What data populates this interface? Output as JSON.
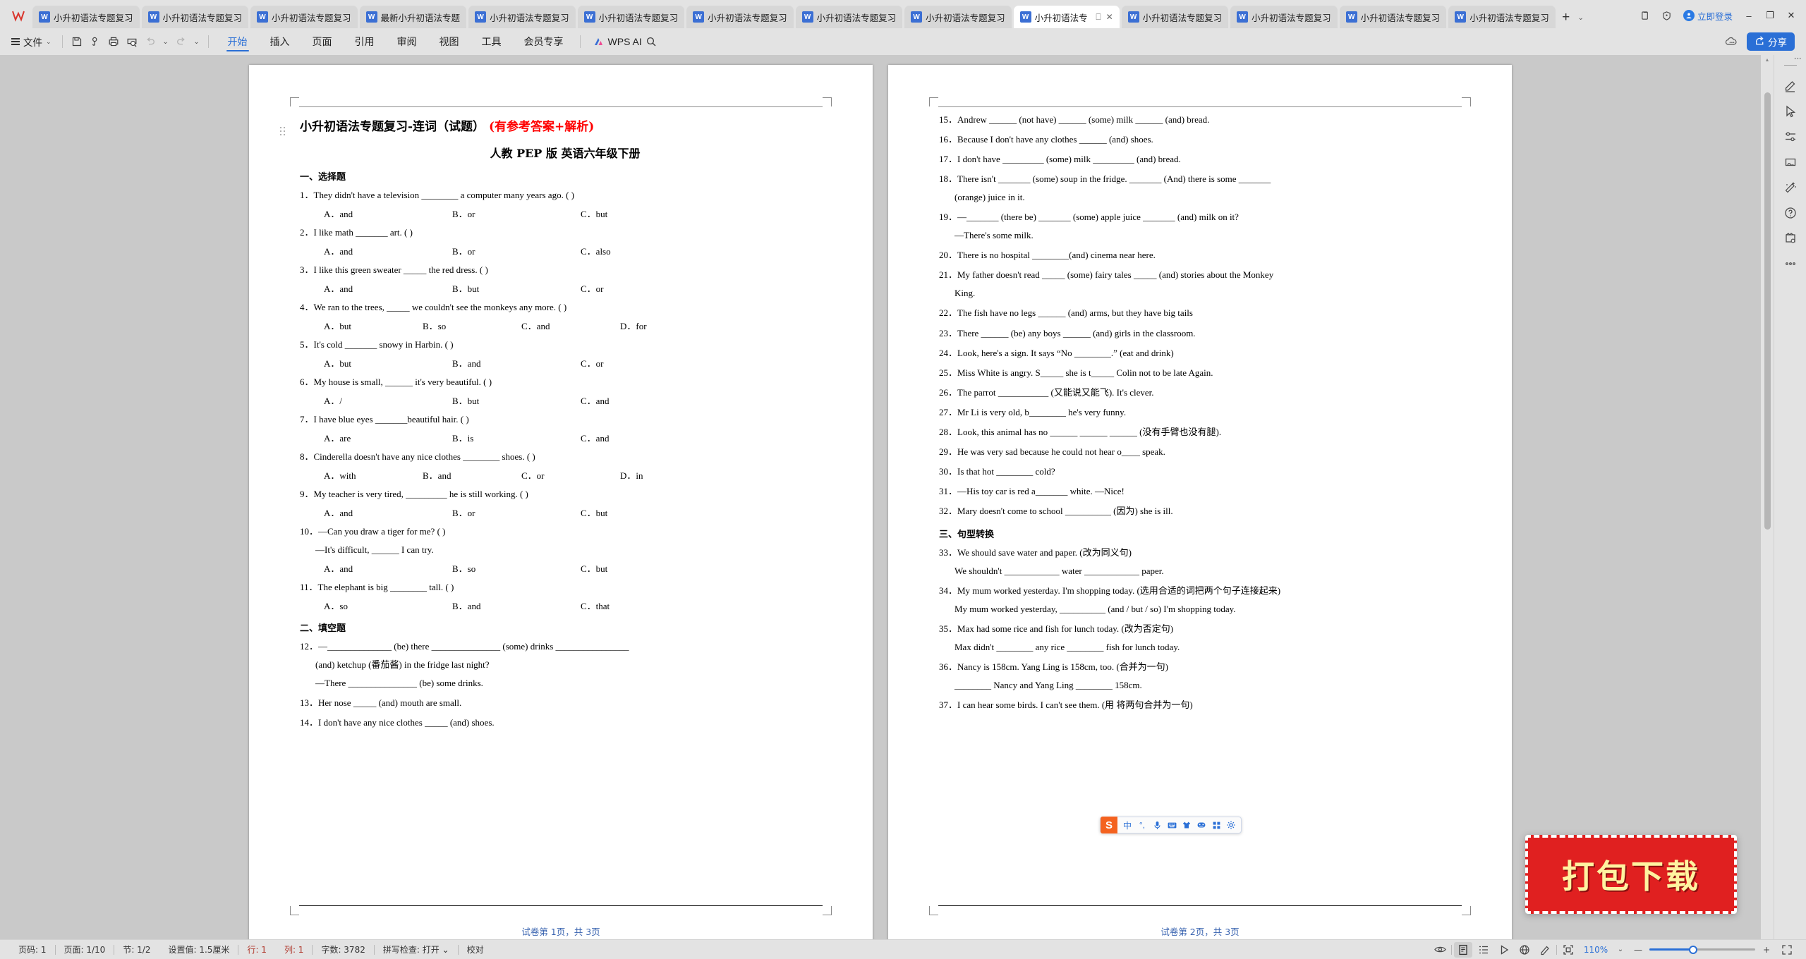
{
  "window": {
    "app_logo": "W",
    "tabs": [
      {
        "label": "小升初语法专题复习",
        "icon": "W",
        "active": false
      },
      {
        "label": "小升初语法专题复习",
        "icon": "W",
        "active": false
      },
      {
        "label": "小升初语法专题复习",
        "icon": "W",
        "active": false
      },
      {
        "label": "最新小升初语法专题",
        "icon": "W",
        "active": false
      },
      {
        "label": "小升初语法专题复习",
        "icon": "W",
        "active": false
      },
      {
        "label": "小升初语法专题复习",
        "icon": "W",
        "active": false
      },
      {
        "label": "小升初语法专题复习",
        "icon": "W",
        "active": false
      },
      {
        "label": "小升初语法专题复习",
        "icon": "W",
        "active": false
      },
      {
        "label": "小升初语法专题复习",
        "icon": "W",
        "active": false
      },
      {
        "label": "小升初语法专",
        "icon": "W",
        "active": true
      },
      {
        "label": "小升初语法专题复习",
        "icon": "W",
        "active": false
      },
      {
        "label": "小升初语法专题复习",
        "icon": "W",
        "active": false
      },
      {
        "label": "小升初语法专题复习",
        "icon": "W",
        "active": false
      },
      {
        "label": "小升初语法专题复习",
        "icon": "W",
        "active": false
      }
    ],
    "new_tab": "+",
    "tab_dropdown": "⌄",
    "login_label": "立即登录",
    "minimize": "–",
    "maximize": "❐",
    "close": "✕"
  },
  "ribbon": {
    "file_label": "文件",
    "tabs": [
      {
        "label": "开始",
        "active": true
      },
      {
        "label": "插入",
        "active": false
      },
      {
        "label": "页面",
        "active": false
      },
      {
        "label": "引用",
        "active": false
      },
      {
        "label": "审阅",
        "active": false
      },
      {
        "label": "视图",
        "active": false
      },
      {
        "label": "工具",
        "active": false
      },
      {
        "label": "会员专享",
        "active": false
      }
    ],
    "ai_label": "WPS AI",
    "share_label": "分享",
    "share_color": "#2a6fd6"
  },
  "document": {
    "title_main": "小升初语法专题复习-连词（试题）",
    "title_red": "(有参考答案+解析)",
    "subtitle": "人教 PEP 版 英语六年级下册",
    "page1_footer": "试卷第 1页，共 3页",
    "page2_footer": "试卷第 2页，共 3页",
    "section1_head": "一、选择题",
    "section2_head": "二、填空题",
    "section3_head": "三、句型转换",
    "page1_items": [
      {
        "kind": "q",
        "text": "1．They didn't have a television ________ a computer many years ago. (        )"
      },
      {
        "kind": "opt3",
        "a": "A．and",
        "b": "B．or",
        "c": "C．but"
      },
      {
        "kind": "q",
        "text": "2．I like math _______ art. (        )"
      },
      {
        "kind": "opt3",
        "a": "A．and",
        "b": "B．or",
        "c": "C．also"
      },
      {
        "kind": "q",
        "text": "3．I like this green sweater _____ the red dress. (  )"
      },
      {
        "kind": "opt3",
        "a": "A．and",
        "b": "B．but",
        "c": "C．or"
      },
      {
        "kind": "q",
        "text": "4．We ran to the trees, _____ we couldn't see the monkeys any more. (  )"
      },
      {
        "kind": "opt4",
        "a": "A．but",
        "b": "B．so",
        "c": "C．and",
        "d": "D．for"
      },
      {
        "kind": "q",
        "text": "5．It's cold _______ snowy in Harbin. (  )"
      },
      {
        "kind": "opt3",
        "a": "A．but",
        "b": "B．and",
        "c": "C．or"
      },
      {
        "kind": "q",
        "text": "6．My house is small, ______ it's very beautiful. (  )"
      },
      {
        "kind": "opt3",
        "a": "A．/",
        "b": "B．but",
        "c": "C．and"
      },
      {
        "kind": "q",
        "text": "7．I have blue eyes _______beautiful hair. (  )"
      },
      {
        "kind": "opt3",
        "a": "A．are",
        "b": "B．is",
        "c": "C．and"
      },
      {
        "kind": "q",
        "text": "8．Cinderella doesn't have any nice clothes ________ shoes. (  )"
      },
      {
        "kind": "opt4",
        "a": "A．with",
        "b": "B．and",
        "c": "C．or",
        "d": "D．in"
      },
      {
        "kind": "q",
        "text": "9．My teacher is very tired, _________ he is still working.   (      )"
      },
      {
        "kind": "opt3",
        "a": "A．and",
        "b": "B．or",
        "c": "C．but"
      },
      {
        "kind": "q",
        "text": "10．—Can you draw a tiger for me? (  )"
      },
      {
        "kind": "plain",
        "text": "—It's difficult, ______ I can try."
      },
      {
        "kind": "opt3",
        "a": "A．and",
        "b": "B．so",
        "c": "C．but"
      },
      {
        "kind": "q",
        "text": "11．The elephant is big ________ tall. (  )"
      },
      {
        "kind": "opt3",
        "a": "A．so",
        "b": "B．and",
        "c": "C．that"
      },
      {
        "kind": "head2",
        "text": "二、填空题"
      },
      {
        "kind": "q",
        "text": "12．—______________ (be) there _______________ (some) drinks ________________"
      },
      {
        "kind": "plain",
        "text": "(and) ketchup (番茄酱) in the fridge last night?"
      },
      {
        "kind": "plain",
        "text": "—There _______________ (be) some drinks."
      },
      {
        "kind": "q",
        "text": "13．Her nose _____ (and) mouth are small."
      },
      {
        "kind": "q",
        "text": "14．I don't have any nice clothes _____ (and) shoes."
      }
    ],
    "page2_items": [
      {
        "kind": "q",
        "text": "15．Andrew ______ (not have) ______ (some) milk ______ (and) bread."
      },
      {
        "kind": "q",
        "text": "16．Because I don't have any clothes ______ (and) shoes."
      },
      {
        "kind": "q",
        "text": "17．I don't have _________ (some) milk _________ (and) bread."
      },
      {
        "kind": "q",
        "text": "18．There isn't _______ (some) soup in the fridge. _______ (And) there is some _______"
      },
      {
        "kind": "plain",
        "text": "(orange) juice in it."
      },
      {
        "kind": "q",
        "text": "19．—_______ (there be) _______ (some) apple juice _______ (and) milk on it?"
      },
      {
        "kind": "plain",
        "text": "—There's some milk."
      },
      {
        "kind": "q",
        "text": "20．There is no hospital ________(and) cinema near here."
      },
      {
        "kind": "q",
        "text": "21．My father doesn't read _____ (some) fairy tales _____ (and) stories about the Monkey"
      },
      {
        "kind": "plain",
        "text": "King."
      },
      {
        "kind": "q",
        "text": "22．The fish have no legs ______ (and) arms, but they have big tails"
      },
      {
        "kind": "q",
        "text": "23．There ______ (be) any boys ______ (and) girls in the classroom."
      },
      {
        "kind": "q",
        "text": "24．Look, here's a sign. It says “No ________.” (eat and drink)"
      },
      {
        "kind": "q",
        "text": "25．Miss White is angry. S_____ she is t_____ Colin not to be late Again."
      },
      {
        "kind": "q",
        "text": "26．The parrot ___________ (又能说又能飞). It's clever."
      },
      {
        "kind": "q",
        "text": "27．Mr Li is very old, b________ he's very funny."
      },
      {
        "kind": "q",
        "text": "28．Look, this animal has no ______ ______ ______ (没有手臂也没有腿)."
      },
      {
        "kind": "q",
        "text": "29．He was very sad because he could not hear o____ speak."
      },
      {
        "kind": "q",
        "text": "30．Is that hot ________ cold?"
      },
      {
        "kind": "q",
        "text": "31．—His toy car is red a_______ white. —Nice!"
      },
      {
        "kind": "q",
        "text": "32．Mary doesn't come to school __________ (因为) she is ill."
      },
      {
        "kind": "head3",
        "text": "三、句型转换"
      },
      {
        "kind": "q",
        "text": "33．We should save water and paper. (改为同义句)"
      },
      {
        "kind": "plain",
        "text": "We shouldn't ____________ water ____________ paper."
      },
      {
        "kind": "q",
        "text": "34．My mum worked yesterday. I'm shopping today. (选用合适的词把两个句子连接起来)"
      },
      {
        "kind": "plain",
        "text": "My mum worked yesterday, __________ (and / but / so) I'm shopping today."
      },
      {
        "kind": "q",
        "text": "35．Max had some rice and fish for lunch today. (改为否定句)"
      },
      {
        "kind": "plain",
        "text": "Max didn't ________ any rice ________ fish for lunch today."
      },
      {
        "kind": "q",
        "text": "36．Nancy is 158cm. Yang Ling is 158cm, too. (合并为一句)"
      },
      {
        "kind": "plain",
        "text": "________ Nancy and Yang Ling ________ 158cm."
      },
      {
        "kind": "q",
        "text": "37．I can hear some birds. I can't see them. (用 将两句合并为一句)"
      }
    ]
  },
  "ime": {
    "logo": "S",
    "buttons": [
      "中",
      "°,",
      "mic-icon",
      "keyboard-icon",
      "skin-icon",
      "emoji-icon",
      "apps-icon",
      "settings-icon"
    ]
  },
  "watermark": {
    "text": "打包下载",
    "bg_color": "#e02020",
    "text_color": "#fff3a0"
  },
  "statusbar": {
    "left_items": [
      {
        "label": "页码: 1",
        "red": false
      },
      {
        "label": "页面: 1/10",
        "red": false
      },
      {
        "label": "节: 1/2",
        "red": false
      },
      {
        "label": "设置值: 1.5厘米",
        "red": false
      },
      {
        "label": "行: 1",
        "red": true
      },
      {
        "label": "列: 1",
        "red": true
      },
      {
        "label": "字数: 3782",
        "red": false
      },
      {
        "label": "拼写检查: 打开 ⌄",
        "red": false
      },
      {
        "label": "校对",
        "red": false
      }
    ],
    "zoom_level": "110%",
    "zoom_minus": "—",
    "zoom_plus": "+"
  },
  "right_rail": {
    "icons": [
      "pen-icon",
      "cursor-icon",
      "sliders-icon",
      "clothes-icon",
      "magic-wand-icon",
      "help-icon",
      "template-icon",
      "more-icon"
    ]
  }
}
